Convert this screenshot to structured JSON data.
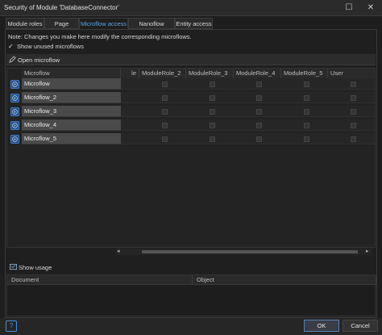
{
  "window": {
    "title": "Security of Module 'DatabaseConnector'",
    "maximize_glyph": "☐",
    "close_glyph": "✕"
  },
  "tabs": [
    {
      "label": "Module roles"
    },
    {
      "label": "Page access"
    },
    {
      "label": "Microflow access",
      "active": true
    },
    {
      "label": "Nanoflow access"
    },
    {
      "label": "Entity access"
    }
  ],
  "note": "Note: Changes you make here modify the corresponding microflows.",
  "show_unused": {
    "label": "Show unused microflows",
    "checked": true
  },
  "toolbar": {
    "open_label": "Open microflow"
  },
  "grid": {
    "columns": [
      "Microflow",
      "le",
      "ModuleRole_2",
      "ModuleRole_3",
      "ModuleRole_4",
      "ModuleRole_5",
      "User"
    ],
    "rows": [
      {
        "name": "Microflow"
      },
      {
        "name": "Microflow_2"
      },
      {
        "name": "Microflow_3"
      },
      {
        "name": "Microflow_4"
      },
      {
        "name": "Microflow_5"
      }
    ]
  },
  "scroll": {
    "left_arrow": "◂",
    "right_arrow": "▸"
  },
  "usage": {
    "label": "Show usage",
    "columns": [
      "Document",
      "Object"
    ]
  },
  "footer": {
    "help": "?",
    "ok": "OK",
    "cancel": "Cancel"
  },
  "colors": {
    "accent": "#5ea4e8",
    "row_fill": "#4a4a4a",
    "microflow_icon": "#3f7fd1"
  },
  "icons": {
    "microflow": "microflow-icon",
    "open": "pencil-icon",
    "usage": "usage-icon",
    "checkbox": "checkbox"
  }
}
